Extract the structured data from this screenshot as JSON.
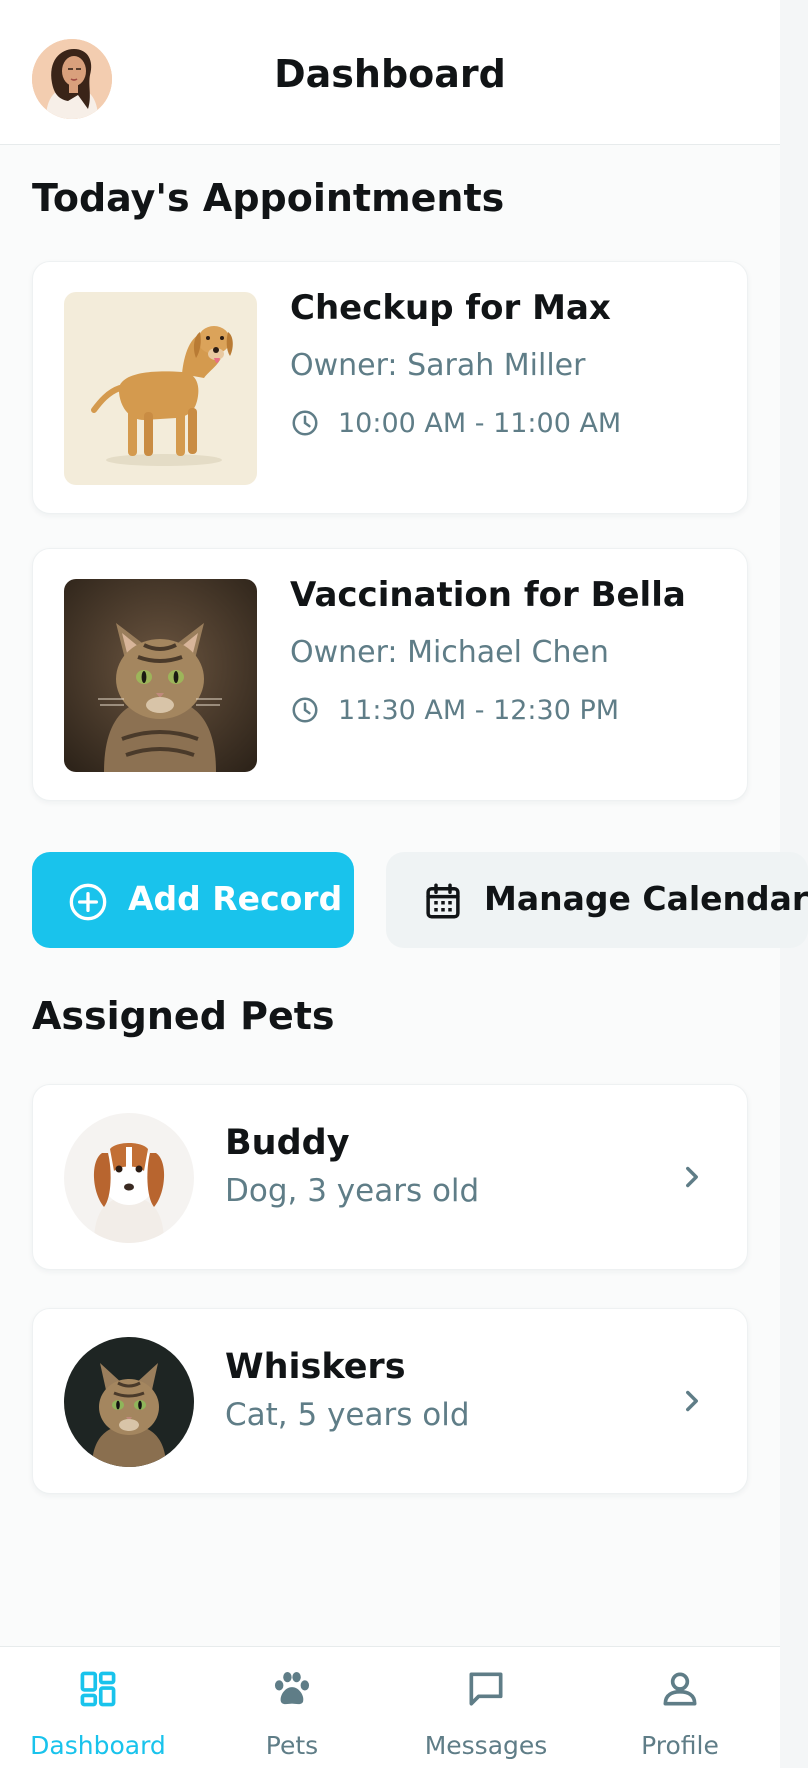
{
  "header": {
    "title": "Dashboard",
    "avatar_icon": "user-avatar"
  },
  "appointments": {
    "section_title": "Today's Appointments",
    "items": [
      {
        "title": "Checkup for Max",
        "owner": "Owner: Sarah Miller",
        "time": "10:00 AM - 11:00 AM",
        "image": "dog-photo"
      },
      {
        "title": "Vaccination for Bella",
        "owner": "Owner: Michael Chen",
        "time": "11:30 AM - 12:30 PM",
        "image": "cat-photo"
      }
    ]
  },
  "actions": {
    "add_record_label": "Add Record",
    "manage_calendar_label": "Manage Calendar",
    "accent": "#19c3ec"
  },
  "pets": {
    "section_title": "Assigned Pets",
    "items": [
      {
        "name": "Buddy",
        "meta": "Dog, 3 years old"
      },
      {
        "name": "Whiskers",
        "meta": "Cat, 5 years old"
      }
    ]
  },
  "nav": {
    "items": [
      {
        "label": "Dashboard",
        "icon": "dashboard-icon",
        "active": true
      },
      {
        "label": "Pets",
        "icon": "paw-icon",
        "active": false
      },
      {
        "label": "Messages",
        "icon": "message-icon",
        "active": false
      },
      {
        "label": "Profile",
        "icon": "user-icon",
        "active": false
      }
    ]
  }
}
